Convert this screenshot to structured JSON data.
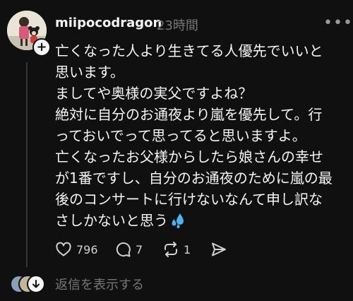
{
  "post": {
    "username": "miipocodragon",
    "timestamp": "23時間",
    "more_icon": "more-horizontal-icon",
    "lines": [
      "亡くなった人より生きてる人優先でいいと",
      "思います。",
      "ましてや奥様の実父ですよね？",
      "絶対に自分のお通夜より嵐を優先して。行",
      "っておいでって思ってると思いますよ。",
      "亡くなったお父様からしたら娘さんの幸せ",
      "が1番ですし、自分のお通夜のために嵐の最",
      "後のコンサートに行けないなんて申し訳な",
      "さしかないと思う"
    ],
    "trailing_emoji": "sweat-droplets-icon"
  },
  "actions": {
    "likes": "796",
    "comments": "7",
    "reposts": "1"
  },
  "replies": {
    "label": "返信を表示する"
  }
}
